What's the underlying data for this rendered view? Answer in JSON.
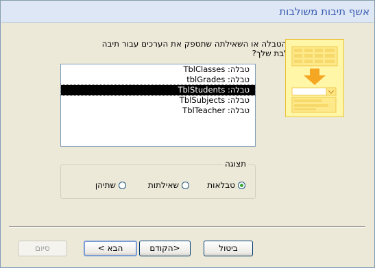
{
  "window": {
    "title": "אשף תיבות משולבות"
  },
  "prompt": "מהי הטבלה או השאילתה שתספק את הערכים עבור תיבה משולבת שלך?",
  "list": {
    "items": [
      "טבלה: TblClasses",
      "טבלה: tblGrades",
      "טבלה: TblStudents",
      "טבלה: TblSubjects",
      "טבלה: TblTeacher"
    ],
    "selected_index": 2
  },
  "view_group": {
    "label": "תצוגה",
    "options": [
      "טבלאות",
      "שאילתות",
      "שתיהן"
    ],
    "selected": "טבלאות"
  },
  "buttons": {
    "cancel": "ביטול",
    "back": "<הקודם",
    "next": "הבא >",
    "finish": "סיום"
  },
  "colors": {
    "title_text": "#3a5bb2",
    "titlebar_bg": "#dde7f5",
    "dialog_bg": "#ece9d8",
    "selection_bg": "#000000",
    "graphic_yellow": "#fff6a8",
    "graphic_orange": "#f5a623"
  },
  "icons": {
    "wizard_graphic": "table-combo-box-illustration"
  }
}
